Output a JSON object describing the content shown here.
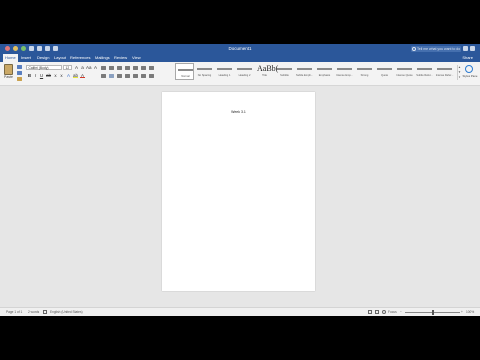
{
  "window": {
    "title": "Document1"
  },
  "search": {
    "placeholder": "Tell me what you want to do"
  },
  "tabs": [
    {
      "label": "Home",
      "active": true
    },
    {
      "label": "Insert"
    },
    {
      "label": "Design"
    },
    {
      "label": "Layout"
    },
    {
      "label": "References"
    },
    {
      "label": "Mailings"
    },
    {
      "label": "Review"
    },
    {
      "label": "View"
    }
  ],
  "share_label": "Share",
  "ribbon": {
    "paste_label": "Paste",
    "font_name": "Calibri (Body)",
    "font_size": "12",
    "styles_pane_label": "Styles Pane",
    "styles": [
      {
        "sample": "AaBbCcDdEe",
        "name": "Normal",
        "selected": true
      },
      {
        "sample": "AaBbCcDdEe",
        "name": "No Spacing"
      },
      {
        "sample": "AaBbCcDdEe",
        "name": "Heading 1"
      },
      {
        "sample": "AaBbCcDdEe",
        "name": "Heading 2"
      },
      {
        "sample": "AaBb(",
        "name": "Title",
        "big": true
      },
      {
        "sample": "AaBbCcDdEe",
        "name": "Subtitle"
      },
      {
        "sample": "AaBbCcDdEe",
        "name": "Subtle Emph..."
      },
      {
        "sample": "AaBbCcDdEe",
        "name": "Emphasis"
      },
      {
        "sample": "AaBbCcDdEe",
        "name": "Intense Emp..."
      },
      {
        "sample": "AaBbCcDdEe",
        "name": "Strong"
      },
      {
        "sample": "AaBbCcDdEe",
        "name": "Quote"
      },
      {
        "sample": "AaBbCcDdEe",
        "name": "Intense Quote"
      },
      {
        "sample": "AaBbCcDdEe",
        "name": "Subtle Refer..."
      },
      {
        "sample": "AaBbCcDdEe",
        "name": "Intense Refer..."
      }
    ]
  },
  "document": {
    "text": "Week 3.1"
  },
  "status": {
    "page": "Page 1 of 1",
    "words": "2 words",
    "language": "English (United States)",
    "focus": "Focus",
    "zoom": "100%"
  },
  "colors": {
    "brand": "#2b579a",
    "ribbon": "#f3f3f3",
    "canvas": "#e6e6e6"
  },
  "icons": [
    "search-icon",
    "paste-icon",
    "styles-pane-icon",
    "zoom-slider"
  ]
}
